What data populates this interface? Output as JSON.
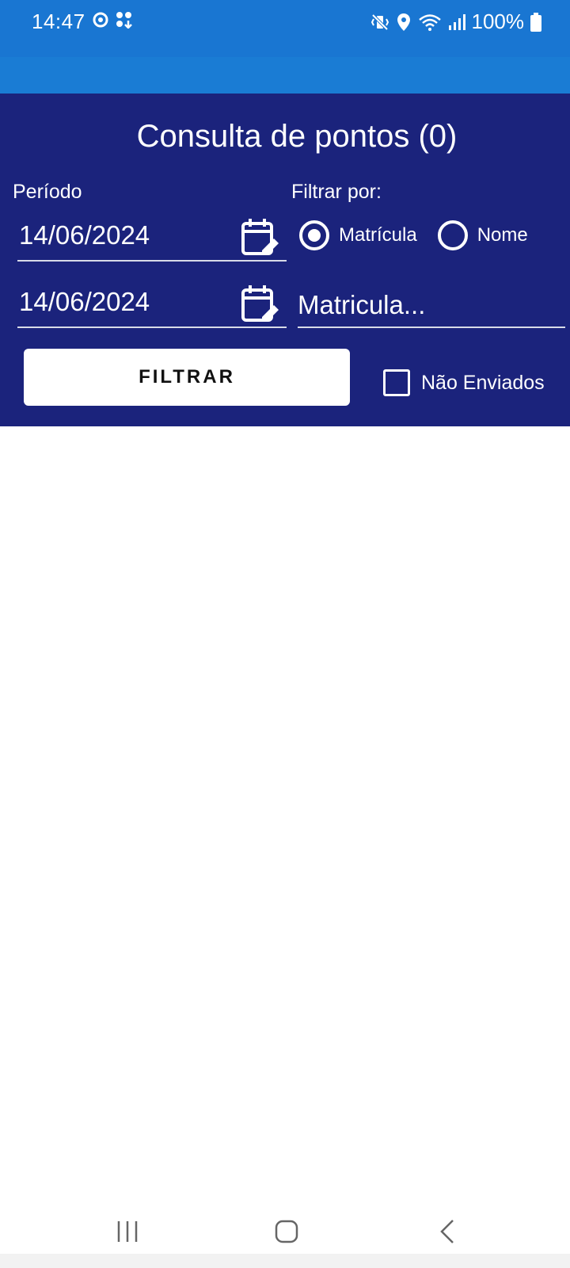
{
  "status_bar": {
    "time": "14:47",
    "battery": "100%"
  },
  "panel": {
    "title": "Consulta de pontos (0)",
    "periodo_label": "Período",
    "filtrar_por_label": "Filtrar por:",
    "date_start": "14/06/2024",
    "date_end": "14/06/2024",
    "radio_options": [
      {
        "label": "Matrícula",
        "checked": true
      },
      {
        "label": "Nome",
        "checked": false
      }
    ],
    "matricula_placeholder": "Matricula...",
    "filter_button_label": "FILTRAR",
    "nao_enviados_label": "Não Enviados",
    "nao_enviados_checked": false
  },
  "colors": {
    "status_bar": "#1976d2",
    "panel_bg": "#1b237c",
    "button_bg": "#ffffff"
  },
  "icons": [
    "settings-sync-icon",
    "download-icon",
    "vibrate-icon",
    "location-icon",
    "wifi-icon",
    "signal-icon",
    "battery-icon",
    "calendar-edit-icon",
    "recent-apps-icon",
    "home-icon",
    "back-icon"
  ]
}
